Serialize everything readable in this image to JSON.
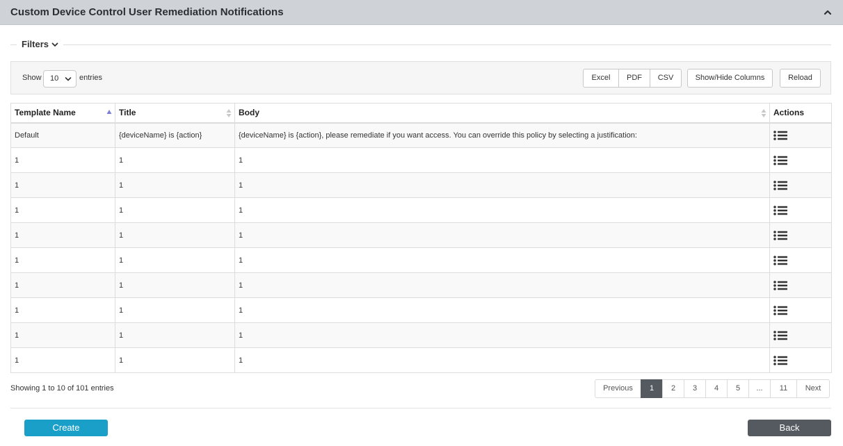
{
  "panel": {
    "title": "Custom Device Control User Remediation Notifications",
    "collapse_icon": "chevron-up-icon"
  },
  "filters": {
    "label": "Filters",
    "icon": "chevron-down-icon"
  },
  "toolbar": {
    "show_label": "Show",
    "page_size": "10",
    "entries_label": "entries",
    "export_buttons": [
      "Excel",
      "PDF",
      "CSV"
    ],
    "show_hide_label": "Show/Hide Columns",
    "reload_label": "Reload"
  },
  "table": {
    "columns": [
      "Template Name",
      "Title",
      "Body",
      "Actions"
    ],
    "sorted_column": "Template Name",
    "sort_direction": "asc",
    "action_icon": "list-icon",
    "rows": [
      [
        "Default",
        "{deviceName} is {action}",
        "{deviceName} is {action}, please remediate if you want access. You can override this policy by selecting a justification:"
      ],
      [
        "1",
        "1",
        "1"
      ],
      [
        "1",
        "1",
        "1"
      ],
      [
        "1",
        "1",
        "1"
      ],
      [
        "1",
        "1",
        "1"
      ],
      [
        "1",
        "1",
        "1"
      ],
      [
        "1",
        "1",
        "1"
      ],
      [
        "1",
        "1",
        "1"
      ],
      [
        "1",
        "1",
        "1"
      ],
      [
        "1",
        "1",
        "1"
      ]
    ]
  },
  "footer": {
    "info": "Showing 1 to 10 of 101 entries",
    "pagination": [
      "Previous",
      "1",
      "2",
      "3",
      "4",
      "5",
      "...",
      "11",
      "Next"
    ],
    "active_page": "1"
  },
  "actions": {
    "create_label": "Create",
    "back_label": "Back"
  },
  "colors": {
    "header_bg": "#cfd3d8",
    "create_button": "#1aa0c8",
    "back_button": "#555960",
    "active_page": "#555960",
    "sort_active": "#7b7fd6"
  }
}
